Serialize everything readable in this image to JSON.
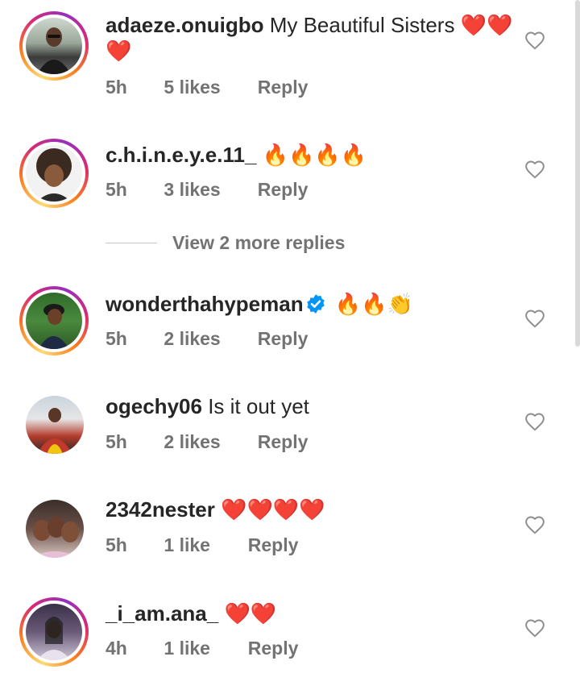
{
  "comments": [
    {
      "username": "adaeze.onuigbo",
      "text": "My Beautiful Sisters",
      "emoji": "❤️❤️❤️",
      "time": "5h",
      "likes": "5 likes",
      "reply": "Reply",
      "story_ring": true
    },
    {
      "username": "c.h.i.n.e.y.e.11_",
      "text": "",
      "emoji": "🔥🔥🔥🔥",
      "time": "5h",
      "likes": "3 likes",
      "reply": "Reply",
      "story_ring": true
    },
    {
      "username": "wonderthahypeman",
      "text": "",
      "emoji": "🔥🔥👏",
      "time": "5h",
      "likes": "2 likes",
      "reply": "Reply",
      "story_ring": true,
      "verified": true
    },
    {
      "username": "ogechy06",
      "text": "Is it out yet",
      "emoji": "",
      "time": "5h",
      "likes": "2 likes",
      "reply": "Reply",
      "story_ring": false
    },
    {
      "username": "2342nester",
      "text": "",
      "emoji": "❤️❤️❤️❤️",
      "time": "5h",
      "likes": "1 like",
      "reply": "Reply",
      "story_ring": false
    },
    {
      "username": "_i_am.ana_",
      "text": "",
      "emoji": "❤️❤️",
      "time": "4h",
      "likes": "1 like",
      "reply": "Reply",
      "story_ring": true
    }
  ],
  "view_more_replies": "View 2 more replies",
  "colors": {
    "text": "#262626",
    "secondary": "#737373",
    "verified": "#0095f6",
    "heart": "#e0192b"
  },
  "icons": {
    "like": "heart-outline-icon",
    "verified": "verified-badge-icon"
  }
}
